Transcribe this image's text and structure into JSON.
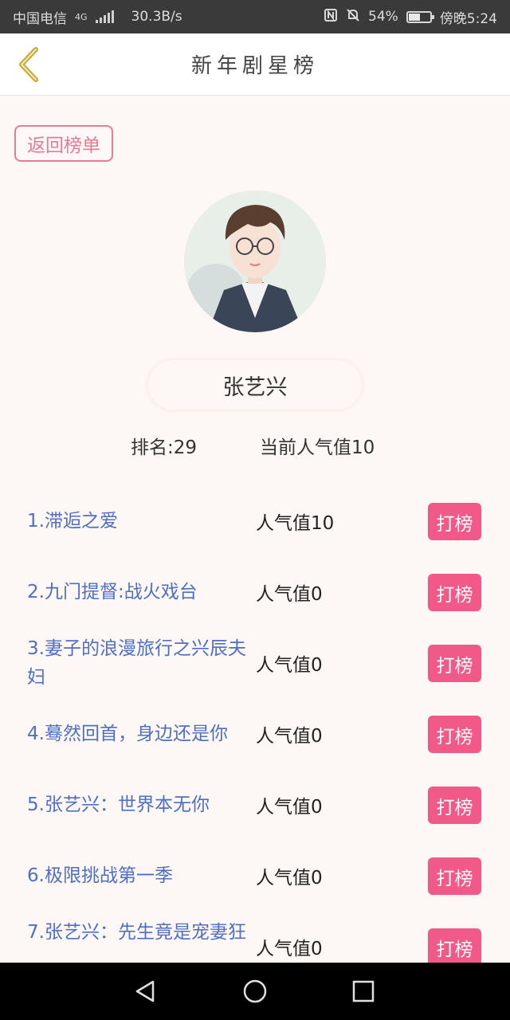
{
  "status_bar": {
    "carrier": "中国电信",
    "network": "4G",
    "speed": "30.3B/s",
    "battery_pct": "54%",
    "battery_level": 0.54,
    "time": "傍晚5:24",
    "icons": [
      "signal-icon",
      "nfc-icon",
      "mute-icon",
      "battery-icon"
    ]
  },
  "header": {
    "title": "新年剧星榜",
    "back_icon": "chevron-left-icon",
    "back_color": "#c9a83a"
  },
  "return_button": {
    "label": "返回榜单"
  },
  "star": {
    "name": "张艺兴",
    "rank": "排名:29",
    "popularity": "当前人气值10"
  },
  "list": {
    "items": [
      {
        "title": "1.滞逅之爱",
        "popularity": "人气值10",
        "button": "打榜"
      },
      {
        "title": "2.九门提督:战火戏台",
        "popularity": "人气值0",
        "button": "打榜"
      },
      {
        "title": "3.妻子的浪漫旅行之兴辰夫妇",
        "popularity": "人气值0",
        "button": "打榜"
      },
      {
        "title": "4.蓦然回首，身边还是你",
        "popularity": "人气值0",
        "button": "打榜"
      },
      {
        "title": "5.张艺兴：世界本无你",
        "popularity": "人气值0",
        "button": "打榜"
      },
      {
        "title": "6.极限挑战第一季",
        "popularity": "人气值0",
        "button": "打榜"
      },
      {
        "title": "7.张艺兴：先生竟是宠妻狂",
        "popularity": "人气值0",
        "button": "打榜"
      }
    ]
  },
  "colors": {
    "accent": "#f15a88",
    "link": "#4e6fc4",
    "return_border": "#e27d93"
  },
  "nav_bar": {
    "icons": [
      "back-triangle-icon",
      "home-circle-icon",
      "recents-square-icon"
    ]
  }
}
